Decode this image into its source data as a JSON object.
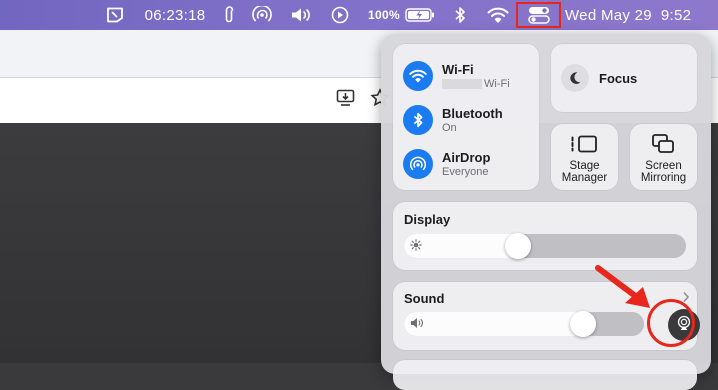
{
  "menubar": {
    "clock": "06:23:18",
    "battery_percent": "100%",
    "date_time": "Wed May 29  9:52"
  },
  "control_center": {
    "wifi": {
      "label": "Wi-Fi",
      "network": "Wi-Fi"
    },
    "bluetooth": {
      "label": "Bluetooth",
      "status": "On"
    },
    "airdrop": {
      "label": "AirDrop",
      "status": "Everyone"
    },
    "focus": {
      "label": "Focus"
    },
    "stage_manager": {
      "line1": "Stage",
      "line2": "Manager"
    },
    "screen_mirroring": {
      "line1": "Screen",
      "line2": "Mirroring"
    },
    "display": {
      "label": "Display",
      "level": 0.45
    },
    "sound": {
      "label": "Sound",
      "level": 0.8
    }
  },
  "colors": {
    "menubar": "#7a6cc6",
    "accent": "#1a7cf0",
    "highlight": "#e8261c"
  }
}
